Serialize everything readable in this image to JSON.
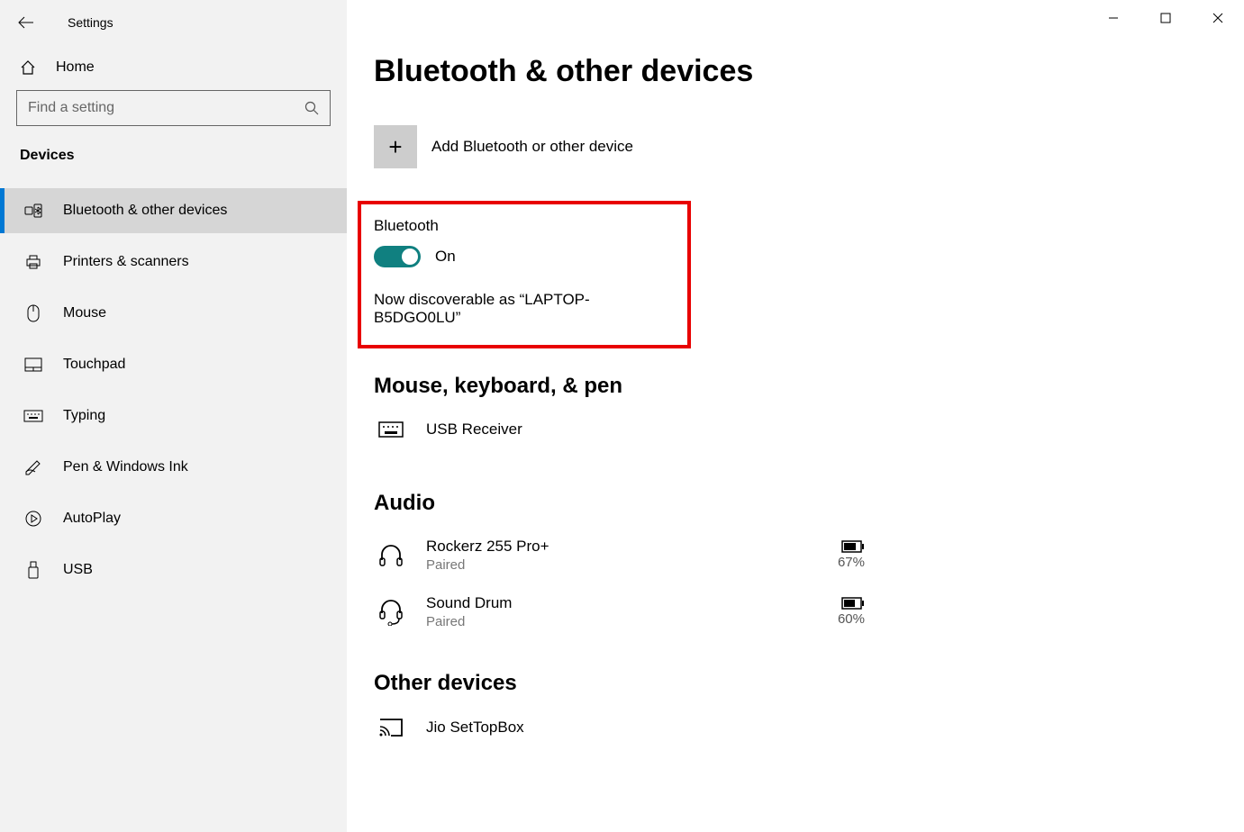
{
  "window": {
    "title": "Settings"
  },
  "sidebar": {
    "home_label": "Home",
    "search_placeholder": "Find a setting",
    "section_label": "Devices",
    "items": [
      {
        "label": "Bluetooth & other devices"
      },
      {
        "label": "Printers & scanners"
      },
      {
        "label": "Mouse"
      },
      {
        "label": "Touchpad"
      },
      {
        "label": "Typing"
      },
      {
        "label": "Pen & Windows Ink"
      },
      {
        "label": "AutoPlay"
      },
      {
        "label": "USB"
      }
    ]
  },
  "main": {
    "title": "Bluetooth & other devices",
    "add_label": "Add Bluetooth or other device",
    "bluetooth": {
      "label": "Bluetooth",
      "state": "On",
      "discoverable": "Now discoverable as “LAPTOP-B5DGO0LU”"
    },
    "categories": {
      "mouse_kb": {
        "title": "Mouse, keyboard, & pen",
        "devices": [
          {
            "name": "USB Receiver"
          }
        ]
      },
      "audio": {
        "title": "Audio",
        "devices": [
          {
            "name": "Rockerz 255 Pro+",
            "status": "Paired",
            "battery": "67%"
          },
          {
            "name": "Sound Drum",
            "status": "Paired",
            "battery": "60%"
          }
        ]
      },
      "other": {
        "title": "Other devices",
        "devices": [
          {
            "name": "Jio SetTopBox"
          }
        ]
      }
    }
  }
}
